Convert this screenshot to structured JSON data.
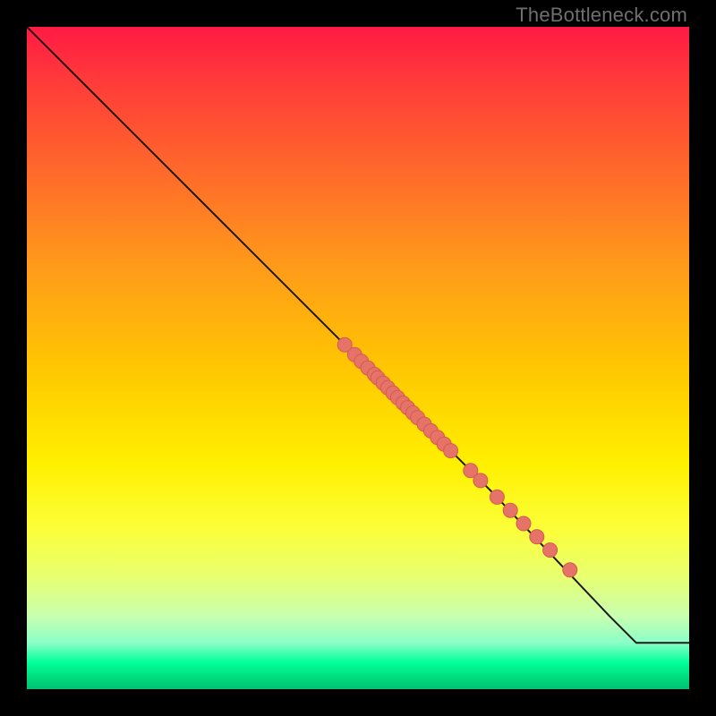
{
  "watermark": "TheBottleneck.com",
  "colors": {
    "background": "#000000",
    "curve": "#1a1a1a",
    "point_fill": "#e57368",
    "point_stroke": "#d65a50"
  },
  "chart_data": {
    "type": "line",
    "title": "",
    "xlabel": "",
    "ylabel": "",
    "xlim": [
      0,
      100
    ],
    "ylim": [
      0,
      100
    ],
    "grid": false,
    "legend": false,
    "series": [
      {
        "name": "curve",
        "style": "line",
        "x": [
          0,
          4,
          10,
          18,
          30,
          50,
          70,
          88,
          92,
          100
        ],
        "y": [
          100,
          96,
          90,
          82,
          70,
          50,
          30,
          11,
          7,
          7
        ]
      },
      {
        "name": "points",
        "style": "scatter",
        "x": [
          48,
          49.5,
          50.5,
          51.5,
          52.5,
          53,
          53.8,
          54.5,
          55.3,
          56,
          56.8,
          57.5,
          58.3,
          59,
          60,
          61,
          62,
          63,
          64,
          67,
          68.5,
          71,
          73,
          75,
          77,
          79,
          82
        ],
        "y": [
          52,
          50.5,
          49.5,
          48.5,
          47.5,
          47,
          46.2,
          45.5,
          44.7,
          44,
          43.2,
          42.5,
          41.7,
          41,
          40,
          39,
          38,
          37,
          36,
          33,
          31.5,
          29,
          27,
          25,
          23,
          21,
          18
        ]
      }
    ]
  }
}
